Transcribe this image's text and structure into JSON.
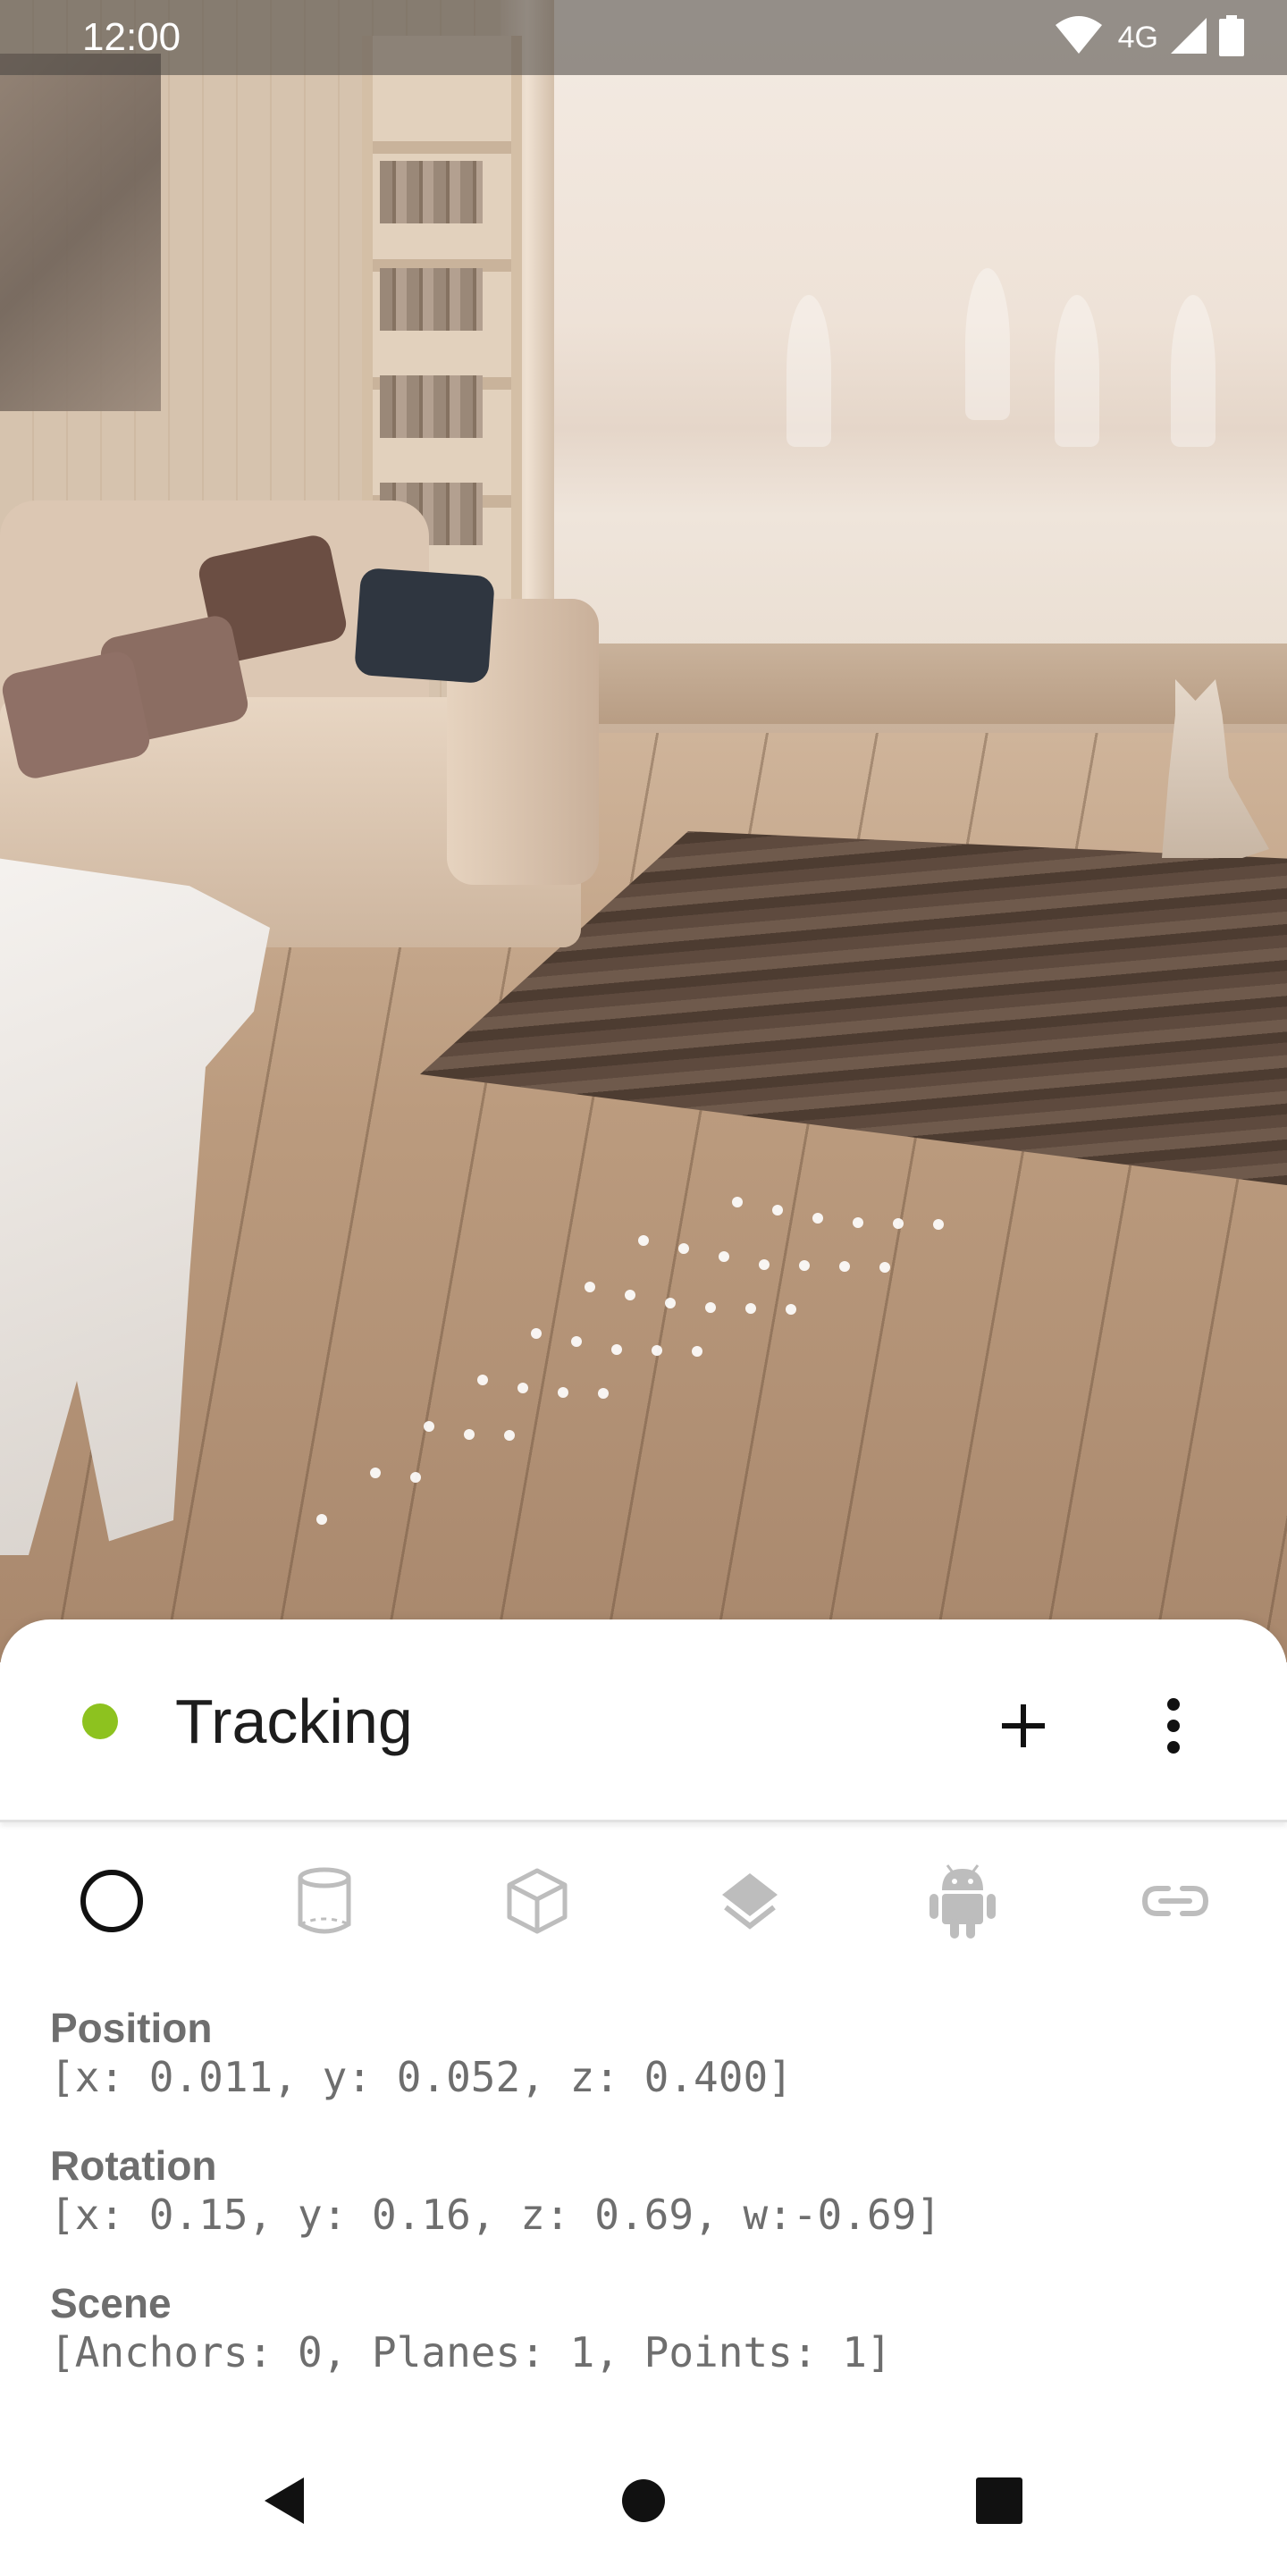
{
  "status_bar": {
    "time": "12:00",
    "network": "4G",
    "icons": [
      "wifi-icon",
      "signal-icon",
      "battery-icon"
    ]
  },
  "sheet": {
    "status": {
      "label": "Tracking",
      "indicator_color": "#8dc21f"
    },
    "actions": [
      "add-icon",
      "more-vert-icon"
    ],
    "tabs": [
      {
        "icon": "circle-icon",
        "selected": true
      },
      {
        "icon": "cylinder-icon",
        "selected": false
      },
      {
        "icon": "cube-icon",
        "selected": false
      },
      {
        "icon": "layers-icon",
        "selected": false
      },
      {
        "icon": "android-icon",
        "selected": false
      },
      {
        "icon": "link-icon",
        "selected": false
      }
    ],
    "info": {
      "position_label": "Position",
      "position_value": "[x: 0.011, y: 0.052, z: 0.400]",
      "rotation_label": "Rotation",
      "rotation_value": "[x: 0.15, y: 0.16, z: 0.69, w:-0.69]",
      "scene_label": "Scene",
      "scene_value": "[Anchors: 0, Planes: 1, Points: 1]"
    }
  },
  "nav_bar": {
    "buttons": [
      "back-icon",
      "home-icon",
      "recents-icon"
    ]
  },
  "colors": {
    "accent_green": "#8dc21f",
    "icon_inactive": "#bdbdbd",
    "text_secondary": "#6e6e6e"
  }
}
